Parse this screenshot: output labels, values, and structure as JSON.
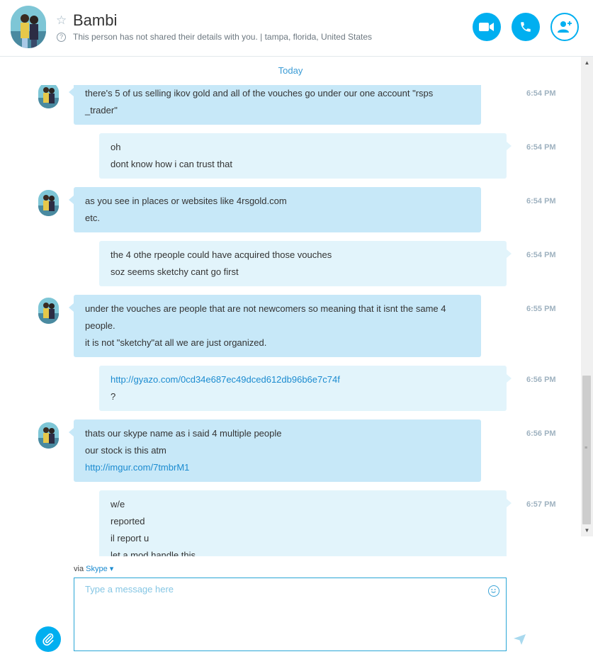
{
  "header": {
    "name": "Bambi",
    "status": "This person has not shared their details with you.  |  tampa, florida, United States",
    "info_glyph": "?",
    "icons": [
      "star-icon",
      "video-call-icon",
      "phone-icon",
      "add-contact-icon"
    ],
    "accent": "#00aff0"
  },
  "chat": {
    "day_label": "Today",
    "messages": [
      {
        "dir": "in",
        "time": "6:54 PM",
        "lines": [
          "there's 5 of us selling ikov gold and all of the vouches go under our one account \"rsps",
          "_trader\""
        ]
      },
      {
        "dir": "out",
        "time": "6:54 PM",
        "lines": [
          "oh",
          "dont know how i can trust that"
        ]
      },
      {
        "dir": "in",
        "time": "6:54 PM",
        "lines": [
          "as you see in places or websites like 4rsgold.com",
          "etc."
        ]
      },
      {
        "dir": "out",
        "time": "6:54 PM",
        "lines": [
          "the 4 othe rpeople could have acquired those vouches",
          "soz seems sketchy cant go first"
        ]
      },
      {
        "dir": "in",
        "time": "6:55 PM",
        "lines": [
          "under the vouches are people that are not newcomers so meaning that it isnt the same 4",
          "people.",
          "it is not \"sketchy\"at all we are just organized."
        ]
      },
      {
        "dir": "out",
        "time": "6:56 PM",
        "lines": [
          "http://gyazo.com/0cd34e687ec49dced612db96b6e7c74f",
          "?"
        ]
      },
      {
        "dir": "in",
        "time": "6:56 PM",
        "lines": [
          "thats our skype name as i said 4 multiple people",
          "our stock is this atm",
          "http://imgur.com/7tmbrM1"
        ]
      },
      {
        "dir": "out",
        "time": "6:57 PM",
        "lines": [
          "w/e",
          "reported",
          "il report u",
          "let a mod handle this"
        ]
      }
    ],
    "incoming_color": "#c7e8f8",
    "outgoing_color": "#e2f4fb"
  },
  "composer": {
    "via_label": "via",
    "via_service": "Skype",
    "placeholder": "Type a message here",
    "icons": [
      "emoji-icon",
      "attach-icon",
      "send-icon"
    ]
  }
}
